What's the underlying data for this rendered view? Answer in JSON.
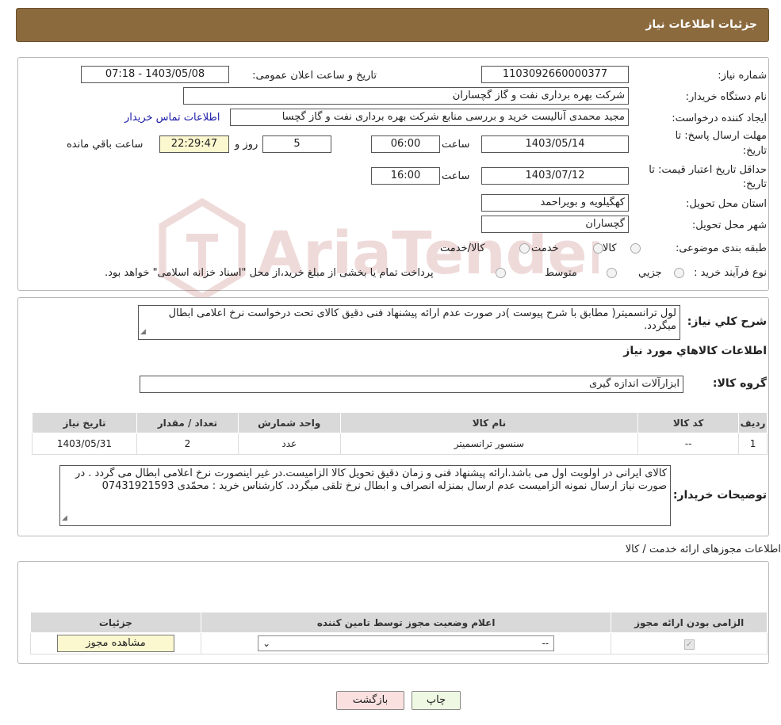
{
  "header": {
    "title": "جزئیات اطلاعات نیاز"
  },
  "form": {
    "need_number_label": "شماره نیاز:",
    "need_number": "1103092660000377",
    "announce_label": "تاریخ و ساعت اعلان عمومی:",
    "announce_value": "1403/05/08 - 07:18",
    "buyer_org_label": "نام دستگاه خریدار:",
    "buyer_org": "شرکت بهره برداری نفت و گاز گچساران",
    "creator_label": "ایجاد کننده درخواست:",
    "creator": "مجید محمدی آنالیست خرید و بررسی منابع شرکت بهره برداری نفت و گاز گچسا",
    "contact_link": "اطلاعات تماس خریدار",
    "deadline_label_1": "مهلت ارسال پاسخ: تا",
    "deadline_label_2": "تاریخ:",
    "deadline_date": "1403/05/14",
    "time_label": "ساعت",
    "deadline_time": "06:00",
    "days_value": "5",
    "days_label": "روز و",
    "remaining_value": "22:29:47",
    "remaining_label": "ساعت باقي مانده",
    "validity_label_1": "حداقل تاریخ اعتبار قیمت: تا",
    "validity_label_2": "تاریخ:",
    "validity_date": "1403/07/12",
    "validity_time": "16:00",
    "province_label": "استان محل تحویل:",
    "province": "کهگیلویه و بویراحمد",
    "city_label": "شهر محل تحویل:",
    "city": "گچساران",
    "category_label": "طبقه بندی موضوعی:",
    "category_options": [
      "کالا",
      "خدمت",
      "کالا/خدمت"
    ],
    "process_label": "نوع فرآیند خرید :",
    "process_options": [
      "جزيي",
      "متوسط"
    ],
    "process_note": "پرداخت تمام یا بخشی از مبلغ خرید،از محل \"اسناد خزانه اسلامی\" خواهد بود."
  },
  "summary": {
    "label": "شرح كلي نياز:",
    "text": "لول ترانسمیتر( مطابق با شرح پیوست )در صورت عدم ارائه پیشنهاد فنی دقیق کالای تحت درخواست نرخ اعلامی ابطال میگردد."
  },
  "goods": {
    "section_title": "اطلاعات كالاهاي مورد نياز",
    "group_label": "گروه كالا:",
    "group_value": "ابزارآلات اندازه گیری",
    "columns": [
      "رديف",
      "كد كالا",
      "نام كالا",
      "واحد شمارش",
      "تعداد / مقدار",
      "تاريخ نياز"
    ],
    "rows": [
      [
        "1",
        "--",
        "سنسور ترانسمیتر",
        "عدد",
        "2",
        "1403/05/31"
      ]
    ]
  },
  "buyer_notes": {
    "label": "توضيحات خريدار:",
    "text": "کالای ایرانی در اولویت اول می باشد.ارائه پیشنهاد فنی و زمان دقیق تحویل کالا الزامیست.در غیر اینصورت نرخ اعلامی ابطال می گردد . در صورت نیاز ارسال نمونه الزامیست عدم ارسال بمنزله انصراف و ابطال نرخ تلقی میگردد. کارشناس خرید : محمّدی  07431921593"
  },
  "permits": {
    "section_title": "اطلاعات مجوزهای ارائه خدمت / کالا",
    "columns": [
      "الزامی بودن ارائه مجوز",
      "اعلام وضعیت مجوز توسط تامین کننده",
      "جزئیات"
    ],
    "select_value": "--",
    "view_button": "مشاهده مجوز"
  },
  "actions": {
    "print": "چاپ",
    "back": "بازگشت"
  },
  "watermark": {
    "text": "AriaTender.neT"
  }
}
